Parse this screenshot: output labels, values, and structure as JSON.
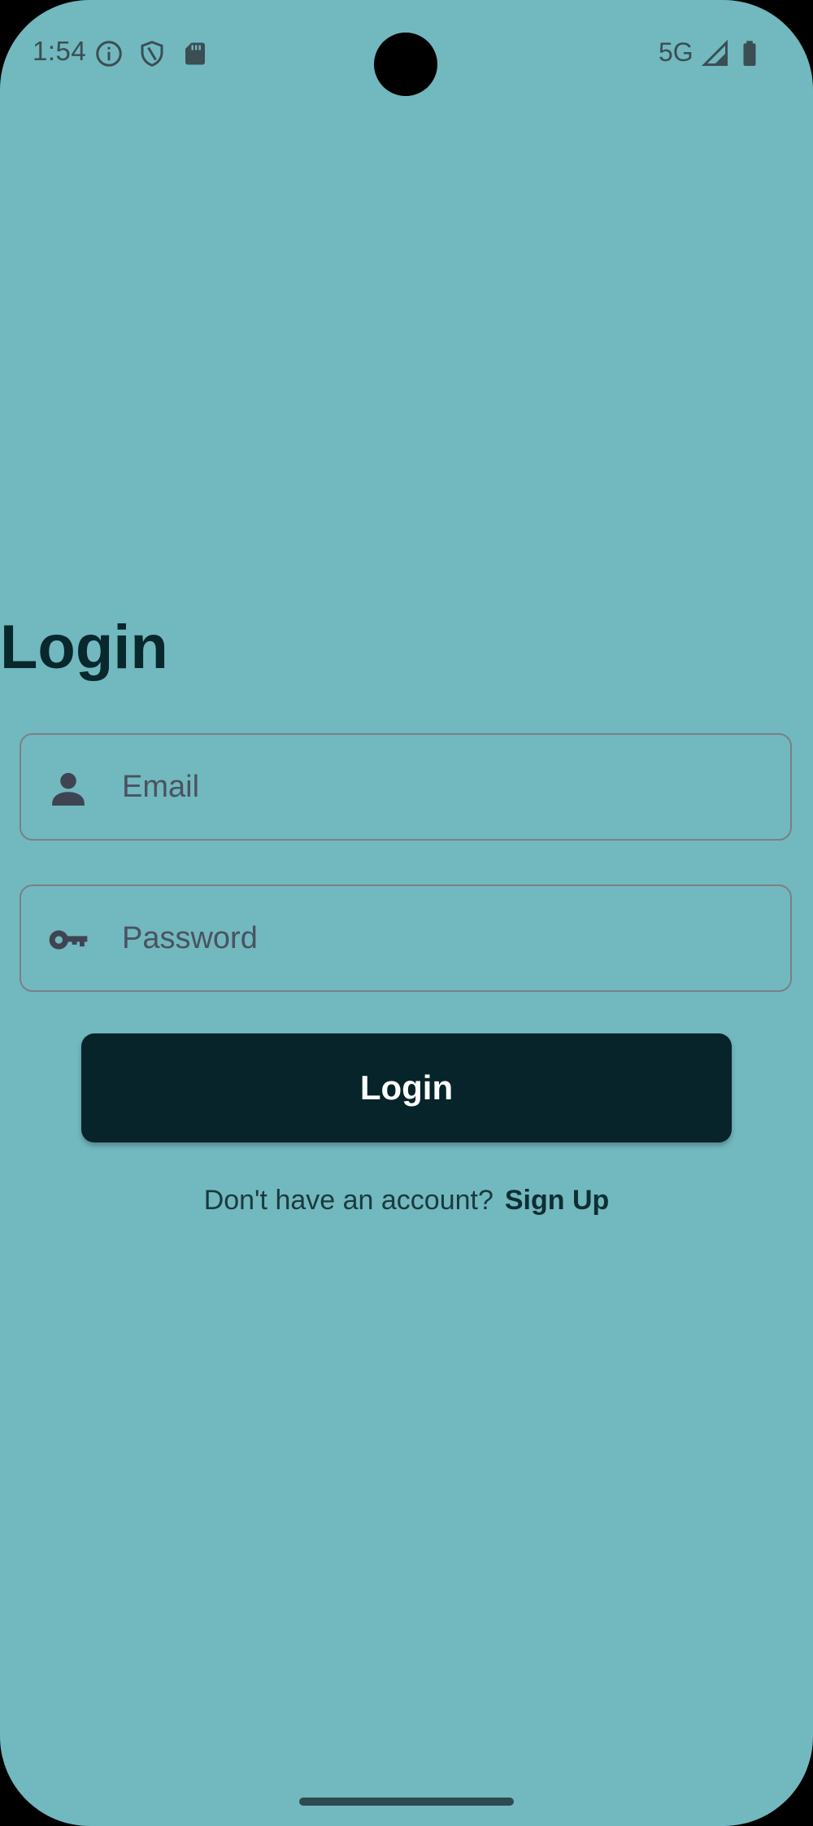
{
  "status_bar": {
    "time": "1:54",
    "network": "5G",
    "icons": [
      "info-icon",
      "shield-icon",
      "sd-card-icon",
      "signal-icon",
      "battery-icon"
    ]
  },
  "login": {
    "title": "Login",
    "email_placeholder": "Email",
    "email_value": "",
    "password_placeholder": "Password",
    "password_value": "",
    "button_label": "Login",
    "signup_prompt": "Don't have an account?",
    "signup_link": "Sign Up"
  },
  "colors": {
    "background": "#72b8bf",
    "title": "#08282d",
    "button": "#062429",
    "button_text": "#ffffff",
    "field_border": "#7c7f86"
  }
}
